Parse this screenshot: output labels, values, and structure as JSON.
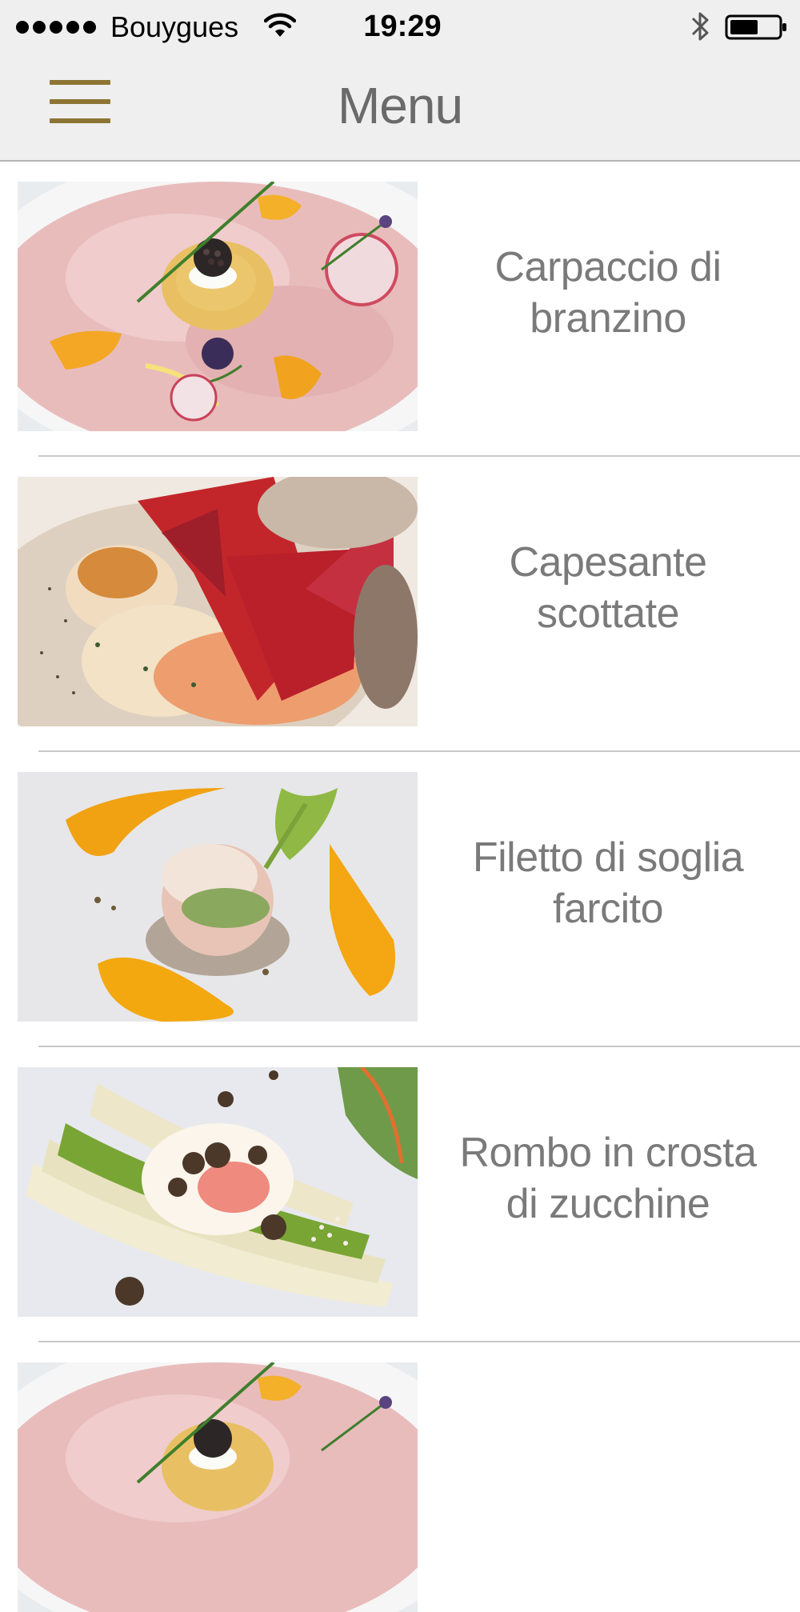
{
  "status_bar": {
    "carrier": "Bouygues",
    "time": "19:29",
    "icons": [
      "signal-dots-icon",
      "wifi-icon",
      "bluetooth-icon",
      "battery-icon"
    ]
  },
  "nav": {
    "title": "Menu",
    "menu_icon": "hamburger-icon",
    "accent_color": "#8c7434"
  },
  "items": [
    {
      "title": "Carpaccio di\nbranzino",
      "image": "carpaccio-photo"
    },
    {
      "title": "Capesante\nscottate",
      "image": "scallops-photo"
    },
    {
      "title": "Filetto di soglia\nfarcito",
      "image": "sole-fillet-photo"
    },
    {
      "title": "Rombo in crosta\ndi zucchine",
      "image": "asparagus-egg-truffle-photo"
    },
    {
      "title": "",
      "image": "carpaccio-photo"
    }
  ]
}
